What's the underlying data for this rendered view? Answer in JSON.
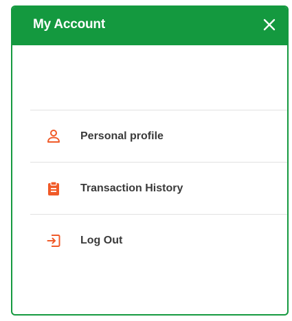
{
  "panel": {
    "title": "My Account",
    "close_icon": "close-icon"
  },
  "menu": {
    "items": [
      {
        "label": "Personal profile",
        "icon": "person-icon"
      },
      {
        "label": "Transaction History",
        "icon": "clipboard-icon"
      },
      {
        "label": "Log Out",
        "icon": "logout-icon"
      }
    ]
  },
  "colors": {
    "header": "#14993f",
    "accent_icon": "#f05a28",
    "label_text": "#3a3a3a",
    "divider": "#e1e1e1"
  }
}
